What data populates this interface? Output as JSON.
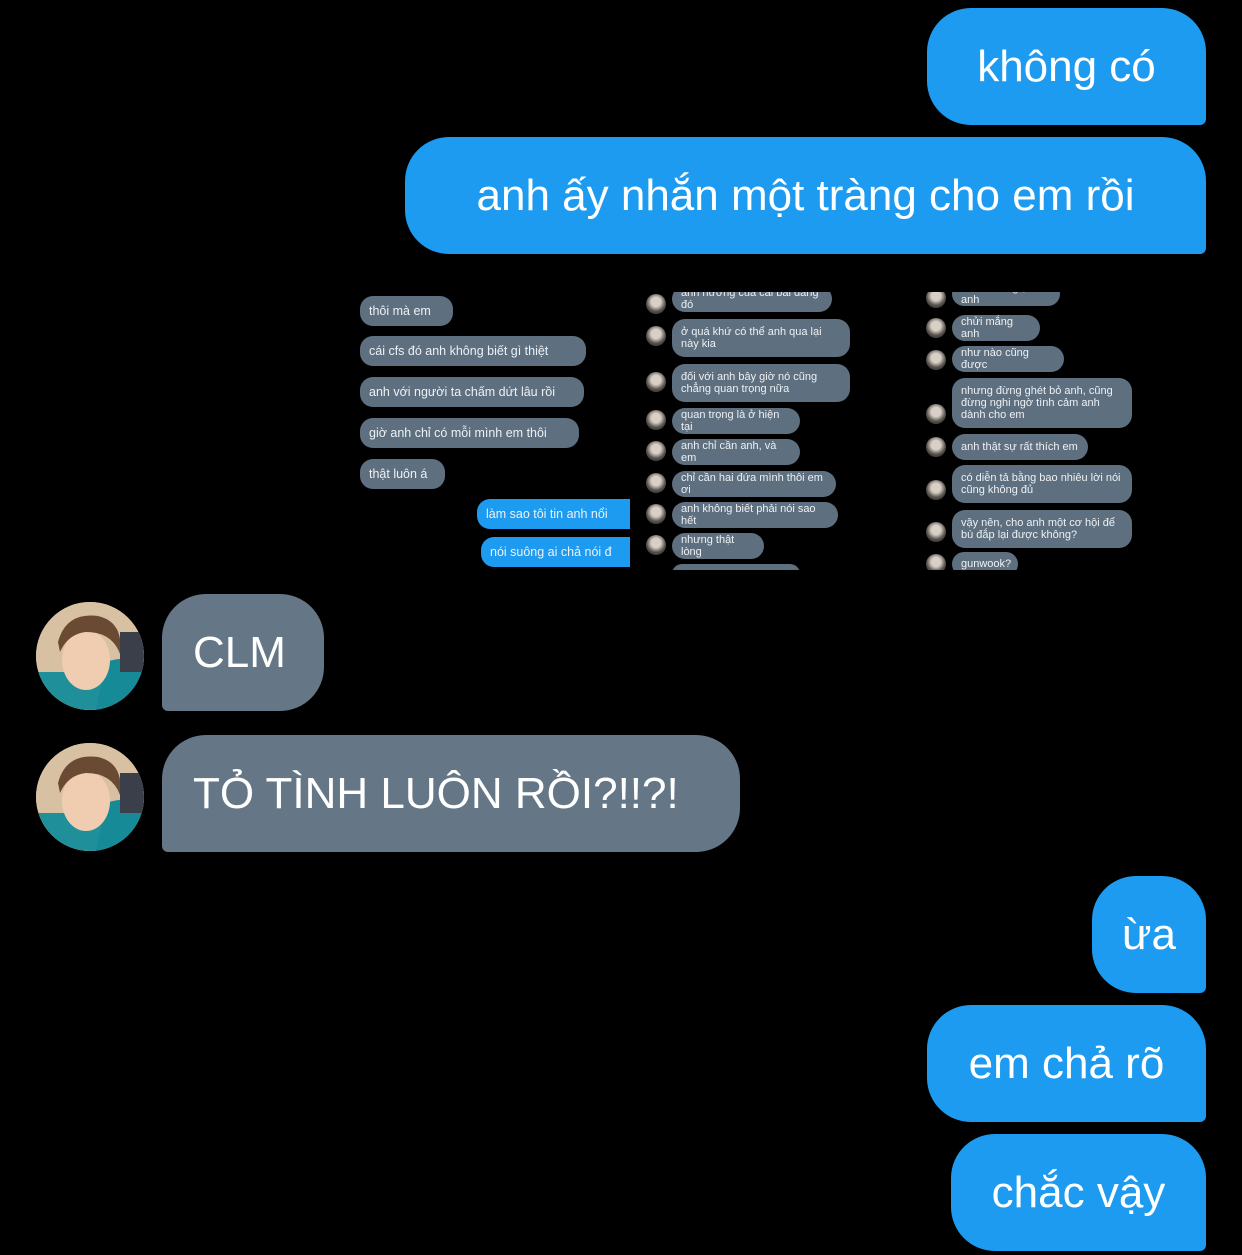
{
  "colors": {
    "outgoing": "#1d9bf0",
    "incoming": "#657786",
    "background": "#000000"
  },
  "messages": [
    {
      "side": "outgoing",
      "text": "không có"
    },
    {
      "side": "outgoing",
      "text": "anh ấy nhắn một tràng cho em rồi"
    },
    {
      "side": "outgoing",
      "type": "image",
      "icon": "chat-screenshot-image"
    },
    {
      "side": "incoming",
      "text": "CLM",
      "avatar": "user-avatar"
    },
    {
      "side": "incoming",
      "text": "TỎ TÌNH LUÔN RỒI?!!?!",
      "avatar": "user-avatar"
    },
    {
      "side": "outgoing",
      "text": "ừa"
    },
    {
      "side": "outgoing",
      "text": "em chả rõ"
    },
    {
      "side": "outgoing",
      "text": "chắc vậy"
    }
  ],
  "screenshot": {
    "col1": [
      {
        "text": "thôi mà em",
        "side": "in"
      },
      {
        "text": "cái cfs đó anh không biết gì thiệt",
        "side": "in"
      },
      {
        "text": "anh với người ta chấm dứt lâu rồi",
        "side": "in"
      },
      {
        "text": "giờ anh chỉ có mỗi mình em thôi",
        "side": "in"
      },
      {
        "text": "thật luôn á",
        "side": "in"
      },
      {
        "text": "làm sao tôi tin anh nổi",
        "side": "out"
      },
      {
        "text": "nói suông ai chả nói đ",
        "side": "out"
      }
    ],
    "col2": [
      {
        "text": "ảnh hưởng của cái bài đăng đó"
      },
      {
        "text": "ở quá khứ có thể anh qua lại này kia"
      },
      {
        "text": "đối với anh bây giờ nó cũng chẳng quan trọng nữa"
      },
      {
        "text": "quan trọng là ở hiện tại"
      },
      {
        "text": "anh chỉ cần anh, và em"
      },
      {
        "text": "chỉ cần hai đứa mình thôi em ơi"
      },
      {
        "text": "anh không biết phải nói sao hết"
      },
      {
        "text": "nhưng thật lòng"
      }
    ],
    "col3": [
      {
        "text": "em có thể giận anh"
      },
      {
        "text": "chửi mắng anh"
      },
      {
        "text": "như nào cũng được"
      },
      {
        "text": "nhưng đừng ghét bỏ anh, cũng đừng nghi ngờ tình cảm anh dành cho em"
      },
      {
        "text": "anh thật sự rất thích em"
      },
      {
        "text": "có diễn tả bằng bao nhiêu lời nói cũng không đủ"
      },
      {
        "text": "vậy nên, cho anh một cơ hội để bù đắp lại được không?"
      },
      {
        "text": "gunwook?"
      }
    ]
  }
}
